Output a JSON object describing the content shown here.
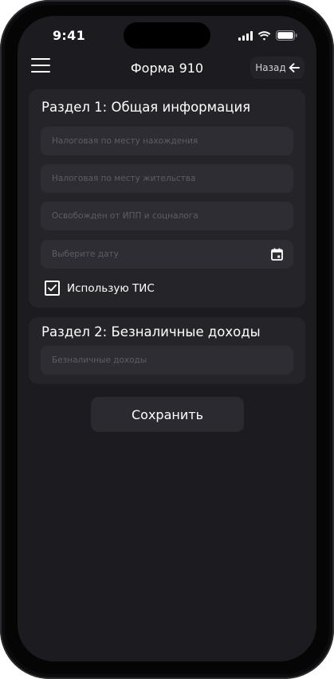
{
  "status_bar": {
    "time": "9:41"
  },
  "header": {
    "title": "Форма 910",
    "back_label": "Назад"
  },
  "section1": {
    "title": "Раздел 1: Общая информация",
    "fields": [
      {
        "placeholder": "Налоговая по месту нахождения"
      },
      {
        "placeholder": "Налоговая по месту жительства"
      },
      {
        "placeholder": "Освобожден от ИПП и соцналога"
      },
      {
        "placeholder": "Выберите дату"
      }
    ],
    "checkbox": {
      "label": "Использую ТИС",
      "checked": true
    }
  },
  "section2": {
    "title": "Раздел 2: Безналичные доходы",
    "fields": [
      {
        "placeholder": "Безналичные доходы"
      }
    ]
  },
  "actions": {
    "save_label": "Сохранить"
  }
}
